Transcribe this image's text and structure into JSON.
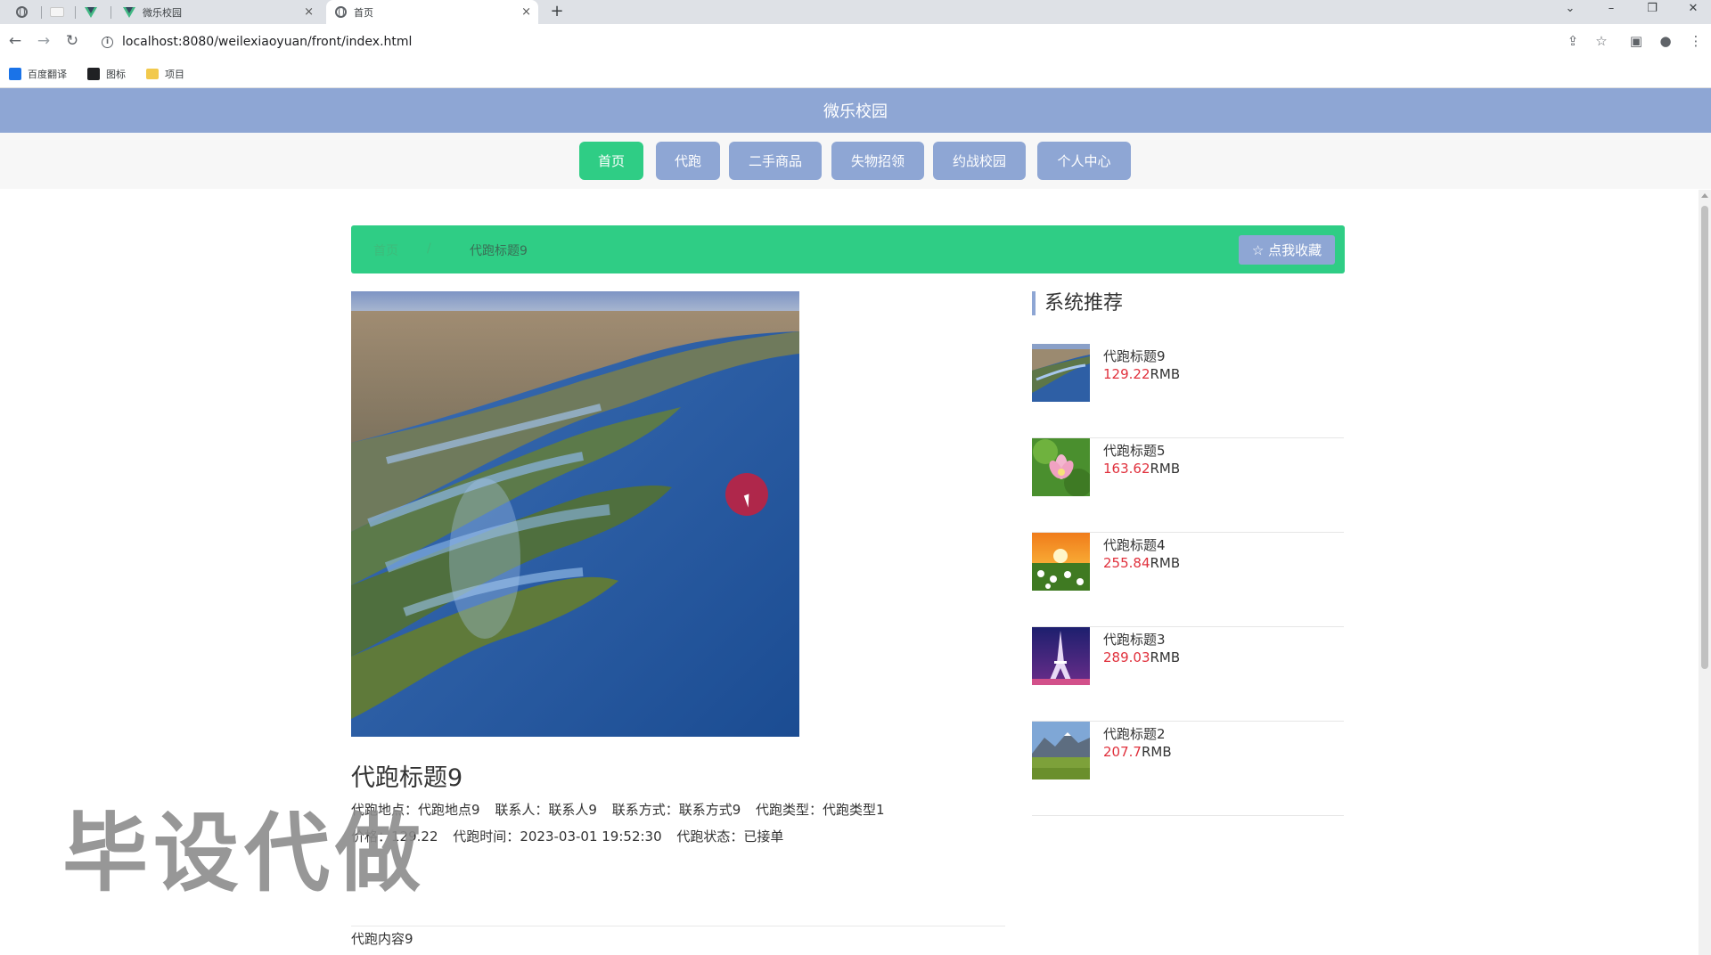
{
  "browser": {
    "tabs": [
      {
        "title": "",
        "icon": "globe-icon"
      },
      {
        "title": "",
        "icon": "blank-page-icon"
      },
      {
        "title": "",
        "icon": "vue-logo-icon"
      },
      {
        "title": "微乐校园",
        "icon": "vue-logo-icon"
      },
      {
        "title": "首页",
        "icon": "globe-icon",
        "active": true
      }
    ],
    "close_glyph": "×",
    "new_tab_glyph": "+",
    "window_controls": {
      "dropdown": "⌄",
      "minimize": "–",
      "restore": "❐",
      "close": "✕"
    },
    "nav": {
      "back": "←",
      "forward": "→",
      "reload": "↻"
    },
    "url": "localhost:8080/weilexiaoyuan/front/index.html",
    "info_glyph": "i",
    "toolbar_icons": {
      "share": "⇪",
      "star": "☆",
      "sidepanel": "▣",
      "profile": "●",
      "menu": "⋮"
    },
    "bookmarks": [
      {
        "label": "百度翻译",
        "icon": "translate-icon",
        "color": "#1a73e8"
      },
      {
        "label": "图标",
        "icon": "picture-icon",
        "color": "#202124"
      },
      {
        "label": "项目",
        "icon": "folder-icon",
        "color": "#f2c94c"
      }
    ]
  },
  "site": {
    "title": "微乐校园",
    "nav": [
      {
        "label": "首页",
        "active": true
      },
      {
        "label": "代跑"
      },
      {
        "label": "二手商品"
      },
      {
        "label": "失物招领"
      },
      {
        "label": "约战校园"
      },
      {
        "label": "个人中心"
      }
    ],
    "accent_color": "#2fcd85",
    "primary_color": "#8ea6d4"
  },
  "breadcrumb": {
    "home": "首页",
    "separator": "/",
    "current": "代跑标题9",
    "favorite_button": "☆ 点我收藏"
  },
  "detail": {
    "title": "代跑标题9",
    "line1": [
      {
        "label": "代跑地点：",
        "value": "代跑地点9"
      },
      {
        "label": "联系人：",
        "value": "联系人9"
      },
      {
        "label": "联系方式：",
        "value": "联系方式9"
      },
      {
        "label": "代跑类型：",
        "value": "代跑类型1"
      }
    ],
    "line2": [
      {
        "label": "价格：",
        "value": "129.22"
      },
      {
        "label": "代跑时间：",
        "value": "2023-03-01 19:52:30"
      },
      {
        "label": "代跑状态：",
        "value": "已接单"
      }
    ],
    "content": "代跑内容9"
  },
  "recommend": {
    "heading": "系统推荐",
    "currency": "RMB",
    "items": [
      {
        "title": "代跑标题9",
        "price": "129.22",
        "thumb": "coastline-photo"
      },
      {
        "title": "代跑标题5",
        "price": "163.62",
        "thumb": "lotus-photo"
      },
      {
        "title": "代跑标题4",
        "price": "255.84",
        "thumb": "sunset-flowers-photo"
      },
      {
        "title": "代跑标题3",
        "price": "289.03",
        "thumb": "eiffel-tower-photo"
      },
      {
        "title": "代跑标题2",
        "price": "207.7",
        "thumb": "mountain-meadow-photo"
      }
    ]
  },
  "watermark": "毕设代做"
}
